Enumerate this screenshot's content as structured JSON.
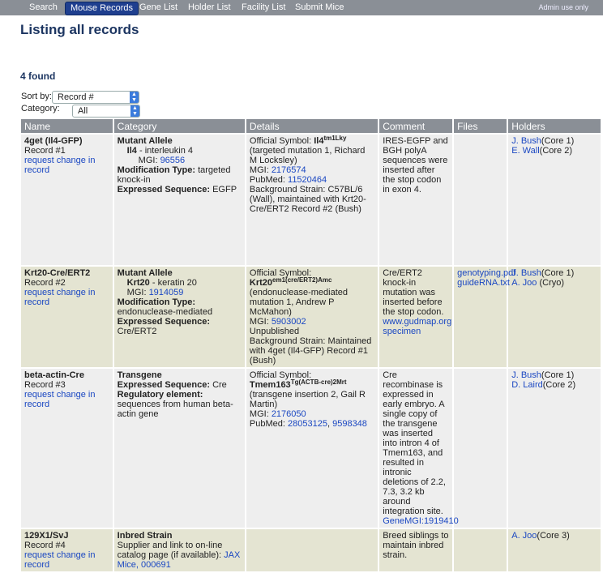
{
  "nav": {
    "items": [
      "Search",
      "Mouse Records",
      "Gene List",
      "Holder List",
      "Facility List",
      "Submit Mice"
    ],
    "active": "Mouse Records",
    "admin": "Admin use only"
  },
  "page": {
    "title": "Listing all records",
    "found": "4 found"
  },
  "sort": {
    "label": "Sort by:",
    "value": "Record #"
  },
  "category": {
    "label": "Category:",
    "value": "All"
  },
  "columns": [
    "Name",
    "Category",
    "Details",
    "Comment",
    "Files",
    "Holders"
  ],
  "rows": [
    {
      "name": "4get (Il4-GFP)",
      "record": "Record #1",
      "change": "request change in record",
      "cat_type": "Mutant Allele",
      "gene": "Il4",
      "gene_sep": " - ",
      "gene_desc": "interleukin 4",
      "mgi_label": "MGI: ",
      "mgi_id": "96556",
      "mod_label": "Modification Type:",
      "mod_value": "targeted knock-in",
      "expr_label": "Expressed Sequence:",
      "expr_value": "EGFP",
      "d_sym_label": "Official Symbol: ",
      "d_sym": "Il4",
      "d_sup": "tm1Lky",
      "d_desc": "(targeted mutation 1, Richard M Locksley)",
      "d_mgi_label": "MGI: ",
      "d_mgi": "2176574",
      "d_pub_label": "PubMed: ",
      "d_pub": "11520464",
      "d_bg": "Background Strain: C57BL/6 (Wall), maintained with Krt20-Cre/ERT2 Record #2 (Bush)",
      "comment": "IRES-EGFP and BGH polyA sequences were inserted after the stop codon in exon 4.",
      "h1_name": "J. Bush",
      "h1_fac": "(Core 1)",
      "h2_name": "E. Wall",
      "h2_fac": "(Core 2)"
    },
    {
      "name": "Krt20-Cre/ERT2",
      "record": "Record #2",
      "change": "request change in record",
      "cat_type": "Mutant Allele",
      "gene": "Krt20",
      "gene_sep": " - ",
      "gene_desc": "keratin 20",
      "mgi_label": "MGI: ",
      "mgi_id": "1914059",
      "mod_label": "Modification Type:",
      "mod_value": "endonuclease-mediated",
      "expr_label": "Expressed Sequence:",
      "expr_value": "Cre/ERT2",
      "d_sym_label": "Official Symbol:",
      "d_sym": "Krt20",
      "d_sup": "em1(cre/ERT2)Amc",
      "d_desc": "(endonuclease-mediated mutation 1, Andrew P McMahon)",
      "d_mgi_label": "MGI: ",
      "d_mgi": "5903002",
      "d_unpub": "Unpublished",
      "d_bg": "Background Strain: Maintained with 4get (Il4-GFP) Record #1 (Bush)",
      "comment": "Cre/ERT2 knock-in mutation was inserted before the stop codon.",
      "comment_link": "www.gudmap.org specimen",
      "file1": "genotyping.pdf",
      "file2": "guideRNA.txt",
      "h1_name": "J. Bush",
      "h1_fac": "(Core 1)",
      "h2_name": "A. Joo",
      "h2_fac": " (Cryo)"
    },
    {
      "name": "beta-actin-Cre",
      "record": "Record #3",
      "change": "request change in record",
      "cat_type": "Transgene",
      "expr_label": "Expressed Sequence:",
      "expr_value": "Cre",
      "reg_label": "Regulatory element:",
      "reg_value": "sequences from human beta-actin gene",
      "d_sym_label": "Official Symbol: ",
      "d_sym": "Tmem163",
      "d_sup": "Tg(ACTB-cre)2Mrt",
      "d_desc": "(transgene insertion 2, Gail R Martin)",
      "d_mgi_label": "MGI: ",
      "d_mgi": "2176050",
      "d_pub_label": "PubMed: ",
      "d_pub": "28053125",
      "d_pub_sep": ", ",
      "d_pub2": "9598348",
      "comment": "Cre recombinase is expressed in early embryo. A single copy of the transgene was inserted into intron 4 of Tmem163, and resulted in intronic deletions of 2.2, 7.3, 3.2 kb around integration site.",
      "comment_link": "GeneMGI:1919410",
      "h1_name": "J. Bush",
      "h1_fac": "(Core 1)",
      "h2_name": "D. Laird",
      "h2_fac": "(Core 2)"
    },
    {
      "name": "129X1/SvJ",
      "record": "Record #4",
      "change": "request change in record",
      "cat_type": "Inbred Strain",
      "supplier": "Supplier and link to on-line catalog page (if available): ",
      "supplier_link": "JAX Mice, 000691",
      "comment": "Breed siblings to maintain inbred strain.",
      "h1_name": "A. Joo",
      "h1_fac": "(Core 3)"
    }
  ]
}
